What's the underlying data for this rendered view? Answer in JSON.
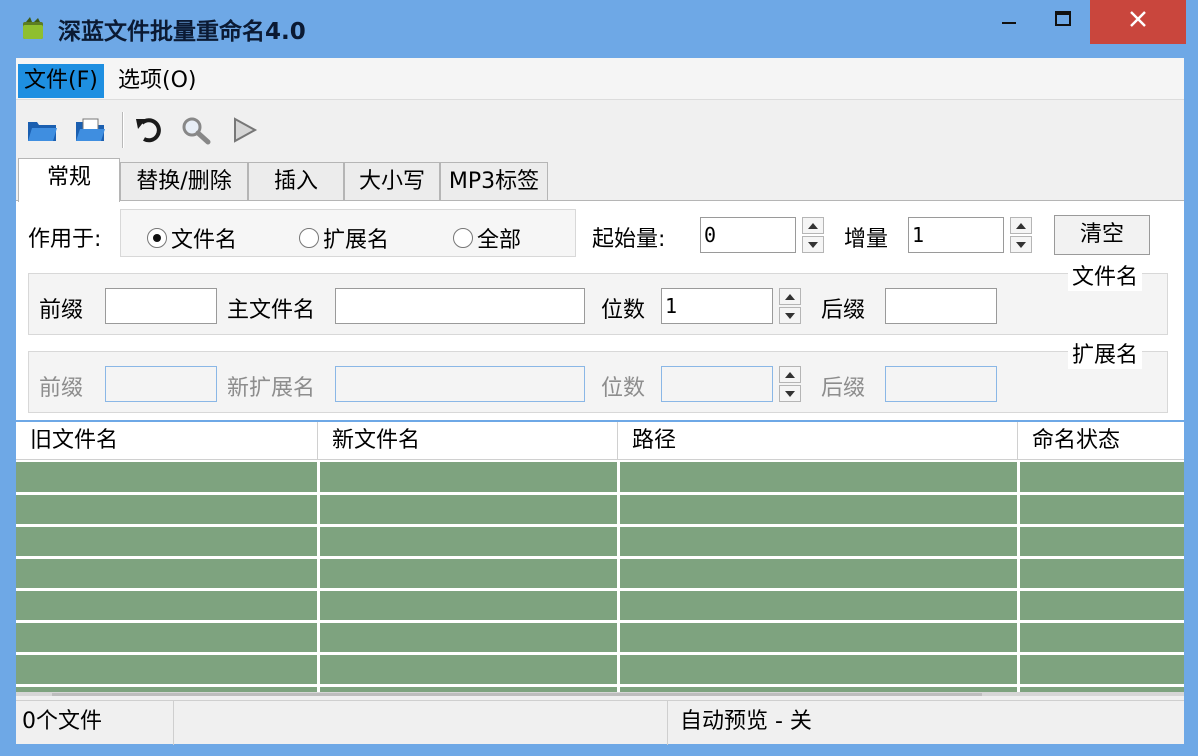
{
  "window": {
    "title": "深蓝文件批量重命名4.0",
    "icon": "folder-app-icon"
  },
  "menu": {
    "file": "文件(F)",
    "options": "选项(O)"
  },
  "toolbar": {
    "icons": [
      "open-folder-icon",
      "open-file-icon",
      "undo-icon",
      "search-icon",
      "play-icon"
    ]
  },
  "tabs": [
    {
      "label": "常规",
      "active": true
    },
    {
      "label": "替换/删除"
    },
    {
      "label": "插入"
    },
    {
      "label": "大小写"
    },
    {
      "label": "MP3标签"
    }
  ],
  "general": {
    "apply_to_label": "作用于:",
    "radios": [
      {
        "label": "文件名",
        "selected": true
      },
      {
        "label": "扩展名",
        "selected": false
      },
      {
        "label": "全部",
        "selected": false
      }
    ],
    "start_label": "起始量:",
    "start_value": "0",
    "increment_label": "增量",
    "increment_value": "1",
    "clear_button": "清空",
    "filename_group": {
      "title": "文件名",
      "prefix_label": "前缀",
      "prefix_value": "",
      "main_label": "主文件名",
      "main_value": "",
      "digits_label": "位数",
      "digits_value": "1",
      "suffix_label": "后缀",
      "suffix_value": ""
    },
    "ext_group": {
      "title": "扩展名",
      "prefix_label": "前缀",
      "new_ext_label": "新扩展名",
      "digits_label": "位数",
      "suffix_label": "后缀"
    }
  },
  "table": {
    "columns": [
      "旧文件名",
      "新文件名",
      "路径",
      "命名状态"
    ],
    "row_color": "#7ea37f"
  },
  "status": {
    "file_count": "0个文件",
    "middle": "",
    "auto_preview": "自动预览 - 关"
  },
  "colors": {
    "titlebar": "#6ea8e6",
    "close": "#c9463d",
    "menu_highlight": "#1e8fe1"
  }
}
